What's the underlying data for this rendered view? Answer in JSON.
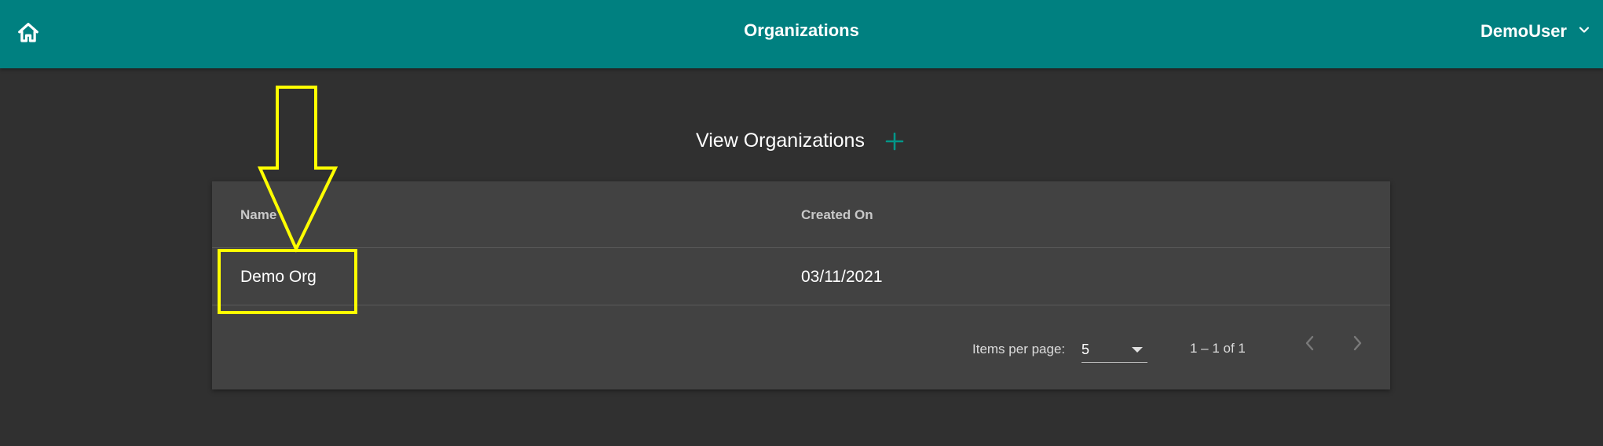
{
  "header": {
    "title": "Organizations",
    "user_name": "DemoUser",
    "bar_color": "#008080",
    "icons": {
      "home": "home-icon",
      "user_menu": "chevron-down-icon"
    }
  },
  "page": {
    "heading": "View Organizations",
    "add_icon": "plus-icon",
    "accent_color": "#009688"
  },
  "table": {
    "columns": [
      "Name",
      "Created On"
    ],
    "rows": [
      {
        "name": "Demo Org",
        "created_on": "03/11/2021"
      }
    ]
  },
  "paginator": {
    "items_per_page_label": "Items per page:",
    "items_per_page_value": "5",
    "range_label": "1 – 1 of 1",
    "prev_icon": "chevron-left-icon",
    "next_icon": "chevron-right-icon"
  },
  "annotation": {
    "highlight_color": "#ffff00",
    "shapes": [
      "arrow",
      "box"
    ]
  }
}
